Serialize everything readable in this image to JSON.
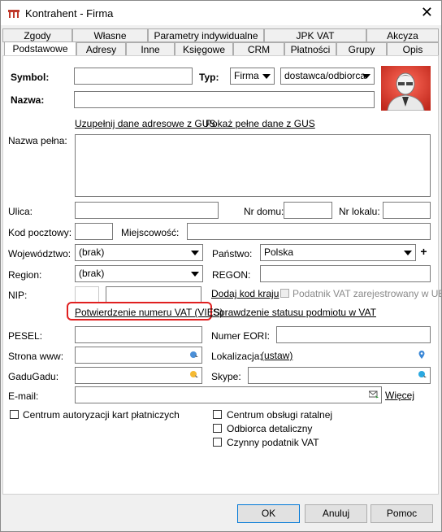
{
  "window": {
    "title": "Kontrahent - Firma",
    "close_glyph": "✕"
  },
  "tabs_row1": [
    "Zgody",
    "Własne",
    "Parametry indywidualne",
    "JPK VAT",
    "Akcyza"
  ],
  "tabs_row2": [
    "Podstawowe",
    "Adresy",
    "Inne",
    "Księgowe",
    "CRM",
    "Płatności",
    "Grupy",
    "Opis"
  ],
  "form": {
    "symbol_label": "Symbol:",
    "typ_label": "Typ:",
    "typ_value": "Firma",
    "typ2_value": "dostawca/odbiorca",
    "nazwa_label": "Nazwa:",
    "gus_link": "Uzupełnij dane adresowe z GUS",
    "gus_full_link": "Pokaż pełne dane z GUS",
    "nazwa_pelna_label": "Nazwa pełna:",
    "ulica_label": "Ulica:",
    "nr_domu_label": "Nr domu:",
    "nr_lokalu_label": "Nr lokalu:",
    "kod_label": "Kod pocztowy:",
    "miejscowosc_label": "Miejscowość:",
    "wojewodztwo_label": "Województwo:",
    "wojewodztwo_value": "(brak)",
    "panstwo_label": "Państwo:",
    "panstwo_value": "Polska",
    "plus_glyph": "+",
    "region_label": "Region:",
    "region_value": "(brak)",
    "regon_label": "REGON:",
    "nip_label": "NIP:",
    "dodaj_kod_link": "Dodaj kod kraju",
    "vat_ue_label": "Podatnik VAT zarejestrowany w UE",
    "vies_link": "Potwierdzenie numeru VAT (VIES)",
    "status_vat_link": "Sprawdzenie statusu podmiotu w VAT",
    "pesel_label": "PESEL:",
    "eori_label": "Numer EORI:",
    "www_label": "Strona www:",
    "lokalizacja_label": "Lokalizacja:",
    "ustaw_link": "(ustaw)",
    "gadugadu_label": "GaduGadu:",
    "skype_label": "Skype:",
    "email_label": "E-mail:",
    "wiecej_link": "Więcej",
    "check_centrum_kart": "Centrum autoryzacji kart płatniczych",
    "check_centrum_ratalnej": "Centrum obsługi ratalnej",
    "check_odbiorca": "Odbiorca detaliczny",
    "check_czynny": "Czynny podatnik VAT"
  },
  "buttons": {
    "ok": "OK",
    "anuluj": "Anuluj",
    "pomoc": "Pomoc"
  },
  "colors": {
    "highlight": "#e02020",
    "accent": "#0078d7"
  }
}
